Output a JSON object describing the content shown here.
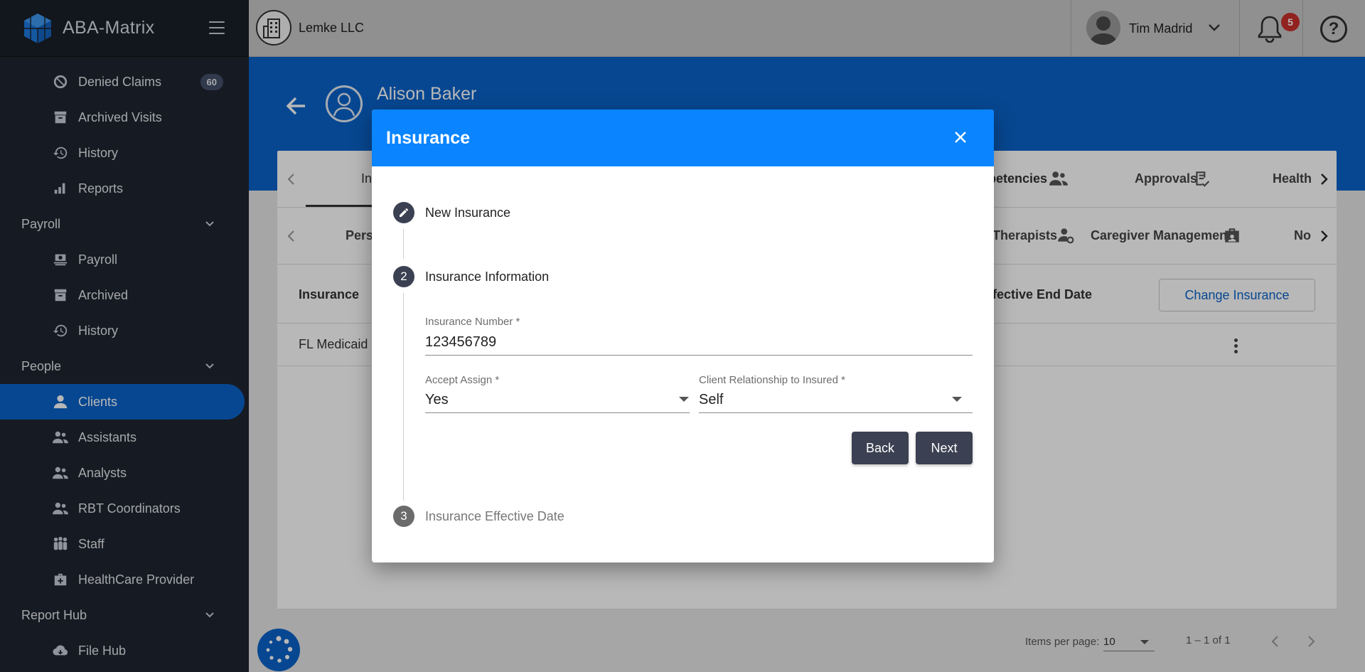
{
  "sidebar": {
    "brand": "ABA-Matrix",
    "items_billing": [
      {
        "label": "Denied Claims",
        "icon": "block-icon",
        "badge": "60"
      },
      {
        "label": "Archived Visits",
        "icon": "archive-icon"
      },
      {
        "label": "History",
        "icon": "history-icon"
      },
      {
        "label": "Reports",
        "icon": "bar-chart-icon"
      }
    ],
    "payroll_section": "Payroll",
    "items_payroll": [
      {
        "label": "Payroll",
        "icon": "payroll-icon"
      },
      {
        "label": "Archived",
        "icon": "archive-icon"
      },
      {
        "label": "History",
        "icon": "history-icon"
      }
    ],
    "people_section": "People",
    "items_people": [
      {
        "label": "Clients",
        "icon": "person-icon"
      },
      {
        "label": "Assistants",
        "icon": "group-icon"
      },
      {
        "label": "Analysts",
        "icon": "group-icon"
      },
      {
        "label": "RBT Coordinators",
        "icon": "group-icon"
      },
      {
        "label": "Staff",
        "icon": "staff-icon"
      },
      {
        "label": "HealthCare Provider",
        "icon": "medical-kit-icon"
      }
    ],
    "report_section": "Report Hub",
    "items_report": [
      {
        "label": "File Hub",
        "icon": "cloud-icon"
      }
    ]
  },
  "topbar": {
    "org_name": "Lemke LLC",
    "user_name": "Tim Madrid",
    "notification_count": "5",
    "help_glyph": "?"
  },
  "client": {
    "name": "Alison Baker"
  },
  "tabs_row1": {
    "first_partial": "In",
    "competencies": "petencies",
    "approvals": "Approvals",
    "health": "Health"
  },
  "tabs_row2": {
    "first_partial": "Perso",
    "therapists": "Therapists",
    "caregiver": "Caregiver Management",
    "no_partial": "No"
  },
  "table": {
    "col_insurance": "Insurance",
    "col_end_date": "ffective End Date",
    "change_button": "Change Insurance",
    "row_insurance": "FL Medicaid"
  },
  "pager": {
    "items_per_page_label": "Items per page:",
    "items_per_page_value": "10",
    "range": "1 – 1 of 1"
  },
  "modal": {
    "title": "Insurance",
    "steps": [
      {
        "label": "New Insurance",
        "state": "done"
      },
      {
        "number": "2",
        "label": "Insurance Information",
        "state": "active"
      },
      {
        "number": "3",
        "label": "Insurance Effective Date",
        "state": "pending"
      }
    ],
    "fields": {
      "insurance_number_label": "Insurance Number *",
      "insurance_number_value": "123456789",
      "accept_assign_label": "Accept Assign *",
      "accept_assign_value": "Yes",
      "relationship_label": "Client Relationship to Insured *",
      "relationship_value": "Self"
    },
    "back_label": "Back",
    "next_label": "Next"
  },
  "colors": {
    "sidebar_bg": "#1f2530",
    "primary_blue": "#0a63c9",
    "modal_header": "#0a84ff",
    "button_dark": "#3b4152",
    "badge_red": "#c9302c"
  }
}
